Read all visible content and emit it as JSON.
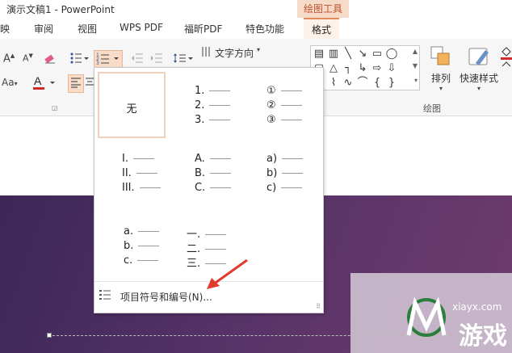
{
  "window": {
    "title": "演示文稿1 - PowerPoint"
  },
  "context_tab": {
    "label": "绘图工具"
  },
  "tabs": [
    {
      "label": "映",
      "active": false
    },
    {
      "label": "审阅",
      "active": false
    },
    {
      "label": "视图",
      "active": false
    },
    {
      "label": "WPS PDF",
      "active": false
    },
    {
      "label": "福昕PDF",
      "active": false
    },
    {
      "label": "特色功能",
      "active": false
    },
    {
      "label": "格式",
      "active": true
    }
  ],
  "ribbon": {
    "text_direction_label": "文字方向",
    "arrange_label": "排列",
    "quick_style_label": "快速样式",
    "drawing_group_label": "绘图"
  },
  "numbering_menu": {
    "none_label": "无",
    "styles": [
      {
        "id": "arabic",
        "items": [
          "1.",
          "2.",
          "3."
        ]
      },
      {
        "id": "circled",
        "items": [
          "①",
          "②",
          "③"
        ]
      },
      {
        "id": "upper-roman",
        "items": [
          "I.",
          "II.",
          "III."
        ]
      },
      {
        "id": "upper-alpha",
        "items": [
          "A.",
          "B.",
          "C."
        ]
      },
      {
        "id": "lower-alpha-paren",
        "items": [
          "a)",
          "b)",
          "c)"
        ]
      },
      {
        "id": "lower-alpha",
        "items": [
          "a.",
          "b.",
          "c."
        ]
      },
      {
        "id": "chinese",
        "items": [
          "一.",
          "二.",
          "三."
        ]
      }
    ],
    "footer_label": "项目符号和编号(N)..."
  },
  "watermark": {
    "text": "游戏",
    "site": "xiayx.com"
  },
  "colors": {
    "accent": "#e58a5b",
    "context_tab_bg": "#f6dcc8",
    "font_color_bar": "#d22b2b",
    "arrow": "#e03b2b"
  }
}
